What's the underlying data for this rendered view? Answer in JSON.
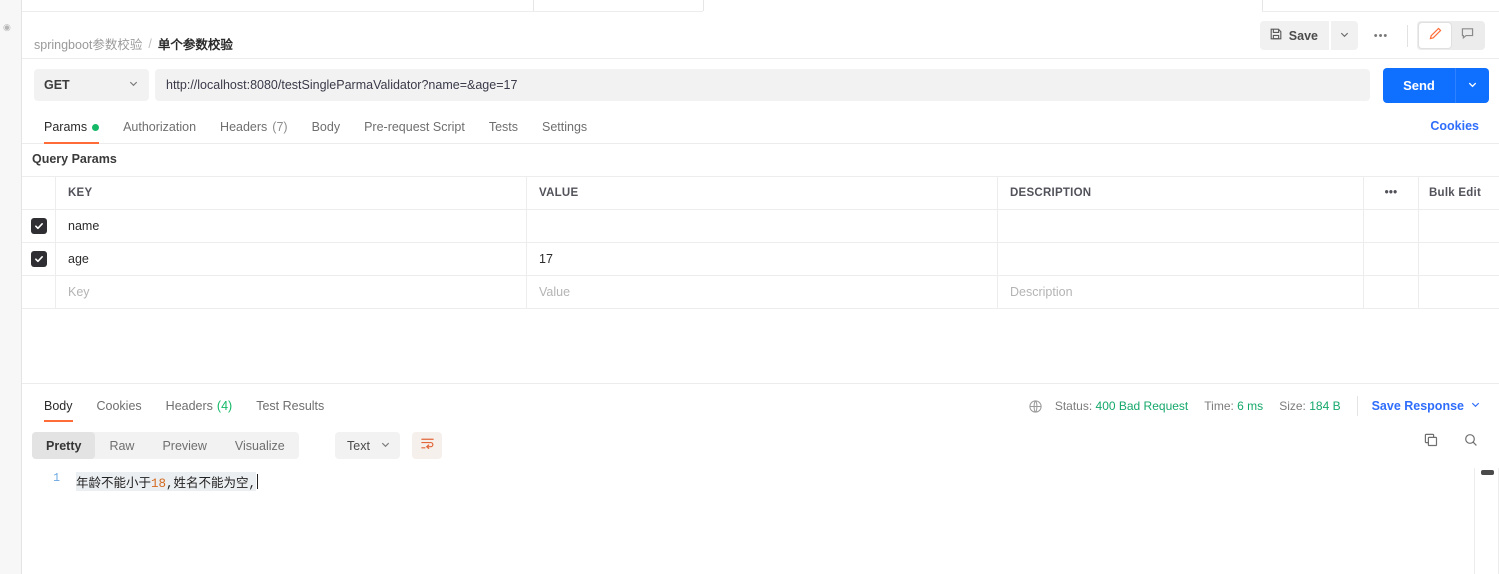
{
  "window": {
    "left_rail_icon": "collapse-dot-icon"
  },
  "breadcrumb": {
    "root": "springboot参数校验",
    "separator": "/",
    "leaf": "单个参数校验"
  },
  "header_actions": {
    "save_label": "Save",
    "save_icon": "floppy-disk-icon",
    "save_caret_icon": "chevron-down-icon",
    "more_icon": "ellipsis-icon",
    "more_label": "•••",
    "edit_icon": "pencil-icon",
    "comment_icon": "comment-icon",
    "accent": "#ff6c37"
  },
  "request": {
    "method": "GET",
    "method_caret_icon": "chevron-down-icon",
    "url": "http://localhost:8080/testSingleParmaValidator?name=&age=17",
    "url_placeholder": "Enter request URL",
    "send_label": "Send",
    "send_caret_icon": "chevron-down-icon",
    "send_color": "#0f6fff"
  },
  "request_tabs": {
    "items": [
      {
        "label": "Params",
        "badge": "dot",
        "active": true
      },
      {
        "label": "Authorization",
        "badge": "",
        "active": false
      },
      {
        "label": "Headers",
        "badge": "(7)",
        "active": false
      },
      {
        "label": "Body",
        "badge": "",
        "active": false
      },
      {
        "label": "Pre-request Script",
        "badge": "",
        "active": false
      },
      {
        "label": "Tests",
        "badge": "",
        "active": false
      },
      {
        "label": "Settings",
        "badge": "",
        "active": false
      }
    ],
    "cookies_link": "Cookies"
  },
  "query_params": {
    "title": "Query Params",
    "columns": [
      "KEY",
      "VALUE",
      "DESCRIPTION"
    ],
    "options_icon": "ellipsis-icon",
    "options_label": "•••",
    "bulk_edit_label": "Bulk Edit",
    "rows": [
      {
        "checked": true,
        "key": "name",
        "value": "",
        "description": ""
      },
      {
        "checked": true,
        "key": "age",
        "value": "17",
        "description": ""
      }
    ],
    "placeholder_row": {
      "key": "Key",
      "value": "Value",
      "description": "Description"
    }
  },
  "response_tabs": {
    "items": [
      {
        "label": "Body",
        "badge": "",
        "active": true
      },
      {
        "label": "Cookies",
        "badge": "",
        "active": false
      },
      {
        "label": "Headers",
        "badge": "(4)",
        "active": false
      },
      {
        "label": "Test Results",
        "badge": "",
        "active": false
      }
    ]
  },
  "response_meta": {
    "globe_icon": "globe-icon",
    "status_label": "Status:",
    "status_value": "400 Bad Request",
    "time_label": "Time:",
    "time_value": "6 ms",
    "size_label": "Size:",
    "size_value": "184 B",
    "save_response_label": "Save Response",
    "save_response_caret_icon": "chevron-down-icon",
    "value_color": "#15a86b",
    "link_color": "#2f6dfb"
  },
  "body_toolbar": {
    "views": [
      {
        "label": "Pretty",
        "active": true
      },
      {
        "label": "Raw",
        "active": false
      },
      {
        "label": "Preview",
        "active": false
      },
      {
        "label": "Visualize",
        "active": false
      }
    ],
    "format": "Text",
    "format_caret_icon": "chevron-down-icon",
    "wrap_icon": "word-wrap-icon",
    "copy_icon": "copy-icon",
    "search_icon": "search-icon"
  },
  "response_body": {
    "line_number": "1",
    "text_before": "年龄不能小于",
    "number": "18",
    "text_after": ",姓名不能为空,"
  }
}
